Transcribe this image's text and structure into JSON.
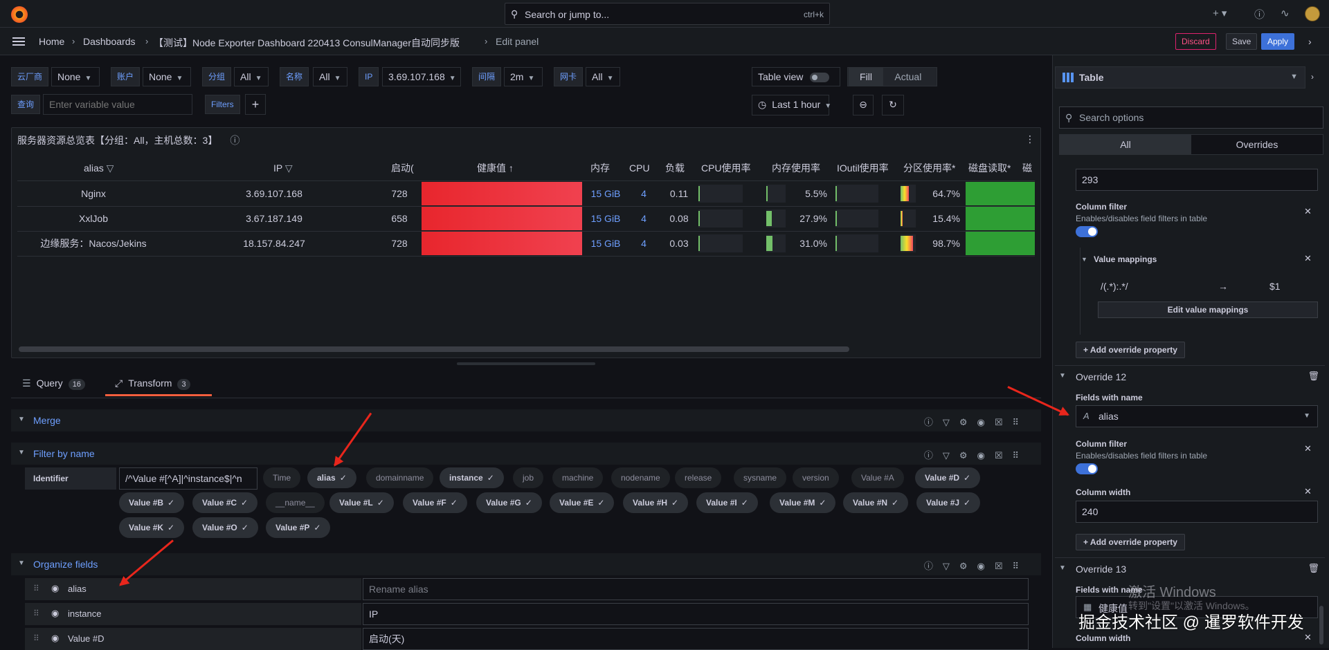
{
  "topbar": {
    "search_placeholder": "Search or jump to...",
    "search_shortcut": "ctrl+k",
    "plus_label": "+",
    "icons": [
      "grafana-logo-icon",
      "plus-icon",
      "help-icon",
      "rss-icon",
      "avatar"
    ]
  },
  "breadcrumb": {
    "items": [
      "Home",
      "Dashboards",
      "【测试】Node Exporter Dashboard 220413 ConsulManager自动同步版",
      "Edit panel"
    ]
  },
  "toolbar": {
    "discard": "Discard",
    "save": "Save",
    "apply": "Apply"
  },
  "variables": [
    {
      "label": "云厂商",
      "value": "None"
    },
    {
      "label": "账户",
      "value": "None"
    },
    {
      "label": "分组",
      "value": "All"
    },
    {
      "label": "名称",
      "value": "All"
    },
    {
      "label": "IP",
      "value": "3.69.107.168"
    },
    {
      "label": "间隔",
      "value": "2m"
    },
    {
      "label": "网卡",
      "value": "All"
    }
  ],
  "query_var": {
    "label": "查询",
    "placeholder": "Enter variable value"
  },
  "filters_label": "Filters",
  "view": {
    "table_view": "Table view",
    "fill": "Fill",
    "actual": "Actual",
    "time_range": "Last 1 hour"
  },
  "panel": {
    "title": "服务器资源总览表【分组：All，主机总数：3】",
    "columns": [
      "alias",
      "IP",
      "启动(",
      "健康值",
      "内存",
      "CPU",
      "负载",
      "CPU使用率",
      "内存使用率",
      "IOutil使用率",
      "分区使用率*",
      "磁盘读取*",
      "磁"
    ],
    "sort_arrow": "↑",
    "rows": [
      {
        "alias": "Nginx",
        "ip": "3.69.107.168",
        "uptime": "728",
        "mem": "15 GiB",
        "cpu": "4",
        "load": "0.11",
        "mem_pct": "5.5%",
        "part_pct": "64.7%",
        "mem_frac": 0.06,
        "part_frac": 0.65
      },
      {
        "alias": "XxlJob",
        "ip": "3.67.187.149",
        "uptime": "658",
        "mem": "15 GiB",
        "cpu": "4",
        "load": "0.08",
        "mem_pct": "27.9%",
        "part_pct": "15.4%",
        "mem_frac": 0.28,
        "part_frac": 0.15
      },
      {
        "alias": "边缘服务：Nacos/Jekins",
        "ip": "18.157.84.247",
        "uptime": "728",
        "mem": "15 GiB",
        "cpu": "4",
        "load": "0.03",
        "mem_pct": "31.0%",
        "part_pct": "98.7%",
        "mem_frac": 0.31,
        "part_frac": 0.99
      }
    ]
  },
  "tabs": [
    {
      "label": "Query",
      "count": "16"
    },
    {
      "label": "Transform",
      "count": "3"
    }
  ],
  "transforms": {
    "merge": "Merge",
    "filter": "Filter by name",
    "organize": "Organize fields",
    "identifier_label": "Identifier",
    "regex": "/^Value #[^A]|^instance$|^n",
    "chips": [
      {
        "label": "Time",
        "on": false
      },
      {
        "label": "alias",
        "on": true
      },
      {
        "label": "domainname",
        "on": false
      },
      {
        "label": "instance",
        "on": true
      },
      {
        "label": "job",
        "on": false
      },
      {
        "label": "machine",
        "on": false
      },
      {
        "label": "nodename",
        "on": false
      },
      {
        "label": "release",
        "on": false
      },
      {
        "label": "sysname",
        "on": false
      },
      {
        "label": "version",
        "on": false
      },
      {
        "label": "Value #A",
        "on": false
      },
      {
        "label": "Value #D",
        "on": true
      },
      {
        "label": "Value #B",
        "on": true
      },
      {
        "label": "Value #C",
        "on": true
      },
      {
        "label": "__name__",
        "on": false
      },
      {
        "label": "Value #L",
        "on": true
      },
      {
        "label": "Value #F",
        "on": true
      },
      {
        "label": "Value #G",
        "on": true
      },
      {
        "label": "Value #E",
        "on": true
      },
      {
        "label": "Value #H",
        "on": true
      },
      {
        "label": "Value #I",
        "on": true
      },
      {
        "label": "Value #M",
        "on": true
      },
      {
        "label": "Value #N",
        "on": true
      },
      {
        "label": "Value #J",
        "on": true
      },
      {
        "label": "Value #K",
        "on": true
      },
      {
        "label": "Value #O",
        "on": true
      },
      {
        "label": "Value #P",
        "on": true
      }
    ],
    "organize_rows": [
      {
        "field": "alias",
        "rename": "Rename alias",
        "placeholder": true
      },
      {
        "field": "instance",
        "rename": "IP",
        "placeholder": false
      },
      {
        "field": "Value #D",
        "rename": "启动(天)",
        "placeholder": false
      }
    ]
  },
  "options": {
    "viz": "Table",
    "search_placeholder": "Search options",
    "tab_all": "All",
    "tab_overrides": "Overrides",
    "width_value_1": "293",
    "column_filter": "Column filter",
    "column_filter_desc": "Enables/disables field filters in table",
    "value_mappings": "Value mappings",
    "vm_regex": "/(.*):.*/",
    "vm_arrow": "→",
    "vm_result": "$1",
    "edit_value_mappings": "Edit value mappings",
    "add_override_property": "+ Add override property",
    "override12": "Override 12",
    "fields_with_name": "Fields with name",
    "field12": "alias",
    "column_width": "Column width",
    "width_value_2": "240",
    "override13": "Override 13",
    "field13": "健康值"
  },
  "watermark": {
    "activate_title": "激活 Windows",
    "activate_desc": "转到\"设置\"以激活 Windows。",
    "community": "掘金技术社区 @ 暹罗软件开发"
  }
}
